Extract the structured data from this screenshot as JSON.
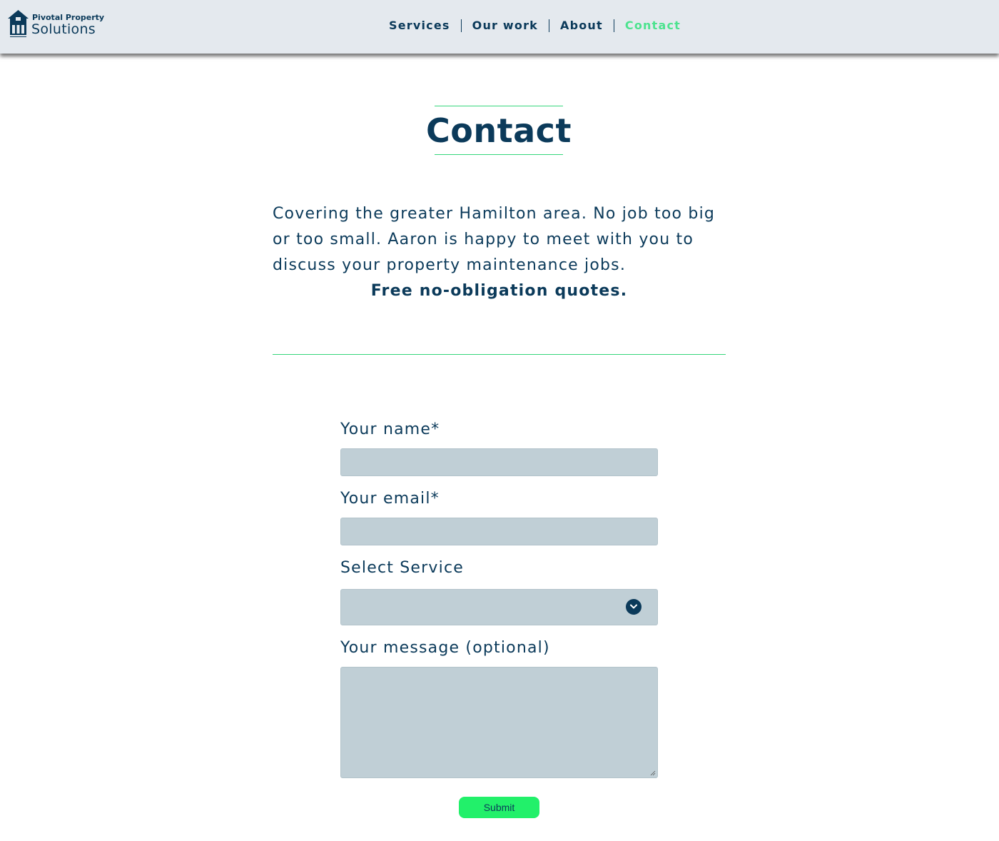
{
  "header": {
    "logo": {
      "line1": "Pivotal Property",
      "line2": "Solutions",
      "icon": "house-icon"
    },
    "nav": [
      {
        "label": "Services",
        "active": false
      },
      {
        "label": "Our work",
        "active": false
      },
      {
        "label": "About",
        "active": false
      },
      {
        "label": "Contact",
        "active": true
      }
    ]
  },
  "main": {
    "title": "Contact",
    "intro": "Covering the greater Hamilton area. No job too big or too small. Aaron is happy to meet with you to discuss your property maintenance jobs.",
    "quote_line": "Free no-obligation quotes."
  },
  "form": {
    "name_label": "Your name*",
    "name_value": "",
    "email_label": "Your email*",
    "email_value": "",
    "service_label": "Select Service",
    "service_value": "",
    "service_icon": "chevron-down-icon",
    "message_label": "Your message (optional)",
    "message_value": "",
    "submit_label": "Submit"
  },
  "colors": {
    "primary": "#0b3a5a",
    "accent": "#4de38f",
    "submit": "#22f06a",
    "header_bg": "#e4e9ee",
    "field_bg": "#c0cfd6"
  }
}
